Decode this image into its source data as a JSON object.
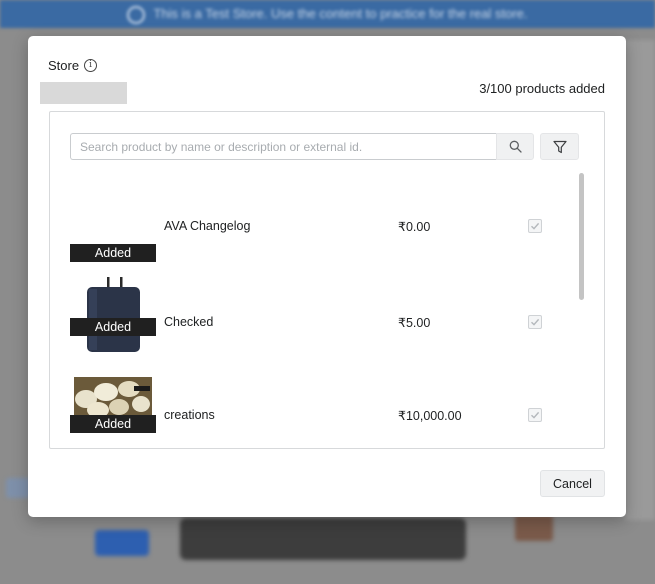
{
  "background": {
    "banner_text": "This is a Test Store. Use the content to practice for the real store."
  },
  "modal": {
    "title": "Store",
    "products_added_text": "3/100 products added",
    "search": {
      "placeholder": "Search product by name or description or external id.",
      "value": ""
    },
    "products": [
      {
        "name": "AVA Changelog",
        "price": "₹0.00",
        "badge": "Added",
        "checked": true,
        "thumbnail": "none"
      },
      {
        "name": "Checked",
        "price": "₹5.00",
        "badge": "Added",
        "checked": true,
        "thumbnail": "dark-charger-image"
      },
      {
        "name": "creations",
        "price": "₹10,000.00",
        "badge": "Added",
        "checked": true,
        "thumbnail": "food-dumplings-image"
      }
    ],
    "cancel_label": "Cancel"
  },
  "icons": {
    "info": "info-icon",
    "search": "search-icon",
    "filter": "filter-icon",
    "check": "checkmark-icon"
  },
  "colors": {
    "badge_bg": "#202020",
    "banner_bg": "#3a6aa3"
  }
}
